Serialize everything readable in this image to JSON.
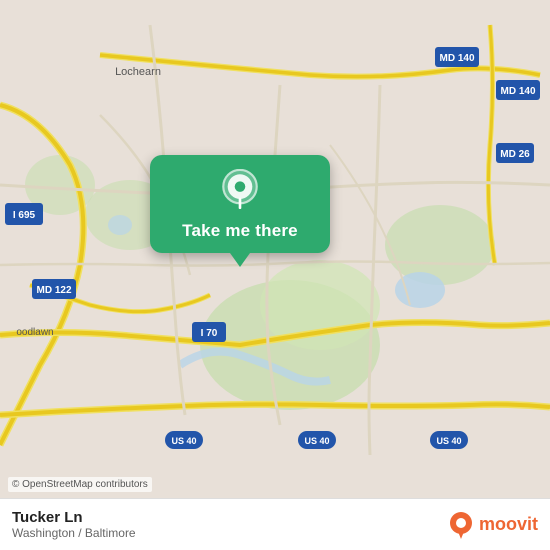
{
  "map": {
    "background_color": "#e8e0d8",
    "copyright": "© OpenStreetMap contributors"
  },
  "button": {
    "label": "Take me there"
  },
  "location": {
    "name": "Tucker Ln",
    "subtitle": "Washington / Baltimore"
  },
  "branding": {
    "moovit_label": "moovit"
  },
  "road_labels": {
    "i695": "I 695",
    "md140": "MD 140",
    "md122": "MD 122",
    "md26": "MD 26",
    "i70": "I 70",
    "us40_1": "US 40",
    "us40_2": "US 40",
    "us40_3": "US 40",
    "lochearn": "Lochearn",
    "woodlawn": "oodlawn"
  }
}
